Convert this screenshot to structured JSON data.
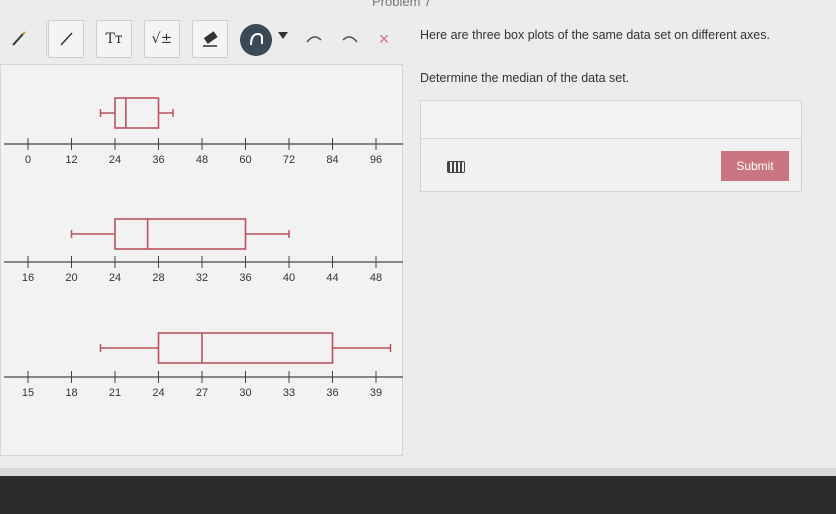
{
  "header": {
    "title": "Problem 7"
  },
  "toolbar": {
    "text_tool": "Tт",
    "math_tool": "√±",
    "close_symbol": "×"
  },
  "question": {
    "line1": "Here are three box plots of the same data set on different axes.",
    "line2": "Determine the median of the data set.",
    "answer_value": "",
    "submit_label": "Submit"
  },
  "colors": {
    "box_stroke": "#b8535f",
    "axis": "#444444",
    "submit": "#c9747e"
  },
  "chart_data": [
    {
      "type": "boxplot",
      "axis_min": 0,
      "axis_max": 96,
      "tick_step": 12,
      "ticks": [
        "0",
        "12",
        "24",
        "36",
        "48",
        "60",
        "72",
        "84",
        "96"
      ],
      "box": {
        "min": 20,
        "q1": 24,
        "median": 27,
        "q3": 36,
        "max": 40
      }
    },
    {
      "type": "boxplot",
      "axis_min": 16,
      "axis_max": 48,
      "tick_step": 4,
      "ticks": [
        "16",
        "20",
        "24",
        "28",
        "32",
        "36",
        "40",
        "44",
        "48"
      ],
      "box": {
        "min": 20,
        "q1": 24,
        "median": 27,
        "q3": 36,
        "max": 40
      }
    },
    {
      "type": "boxplot",
      "axis_min": 15,
      "axis_max": 39,
      "tick_step": 3,
      "ticks": [
        "15",
        "18",
        "21",
        "24",
        "27",
        "30",
        "33",
        "36",
        "39"
      ],
      "box": {
        "min": 20,
        "q1": 24,
        "median": 27,
        "q3": 36,
        "max": 40
      }
    }
  ]
}
